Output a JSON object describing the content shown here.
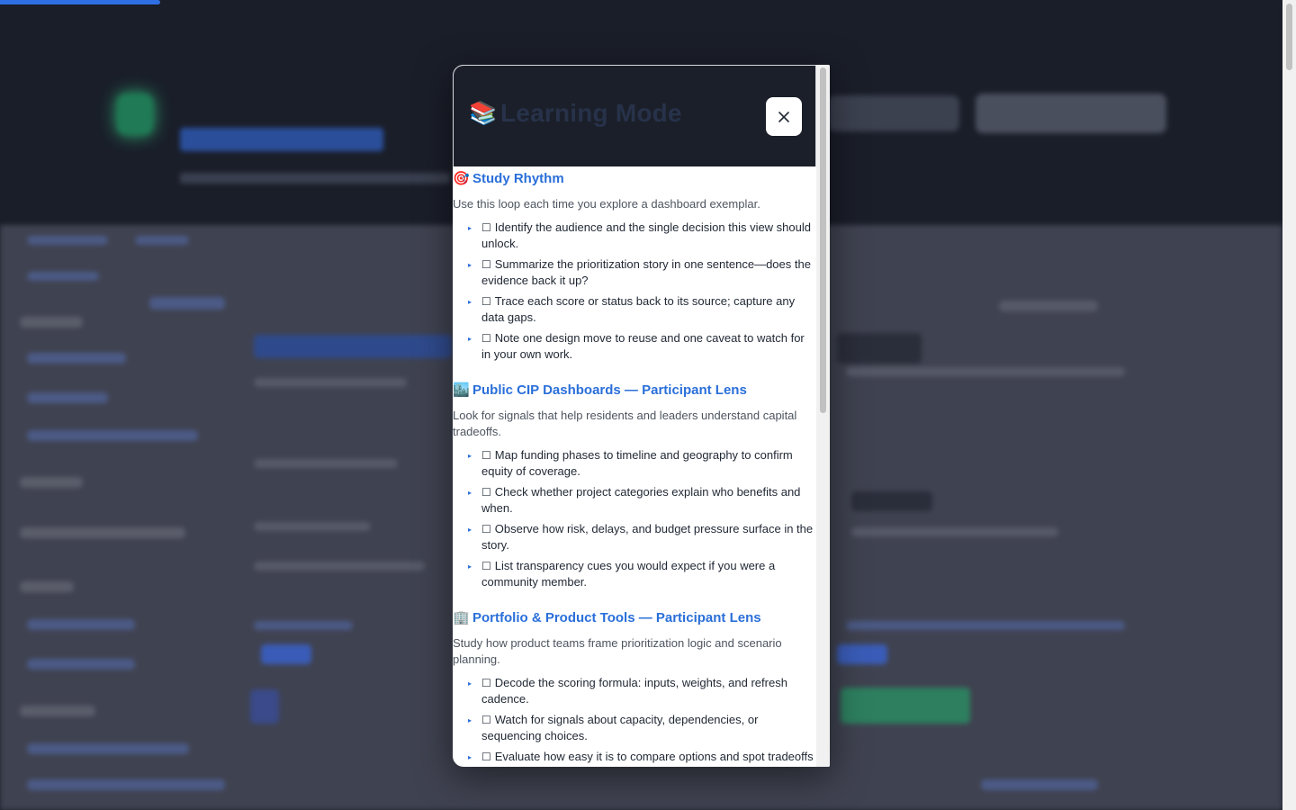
{
  "modal": {
    "icon": "📚",
    "title": "Learning Mode",
    "close_icon": "close-icon",
    "sections": [
      {
        "emoji": "🎯",
        "title": "Study Rhythm",
        "description": "Use this loop each time you explore a dashboard exemplar.",
        "items": [
          "Identify the audience and the single decision this view should unlock.",
          "Summarize the prioritization story in one sentence—does the evidence back it up?",
          "Trace each score or status back to its source; capture any data gaps.",
          "Note one design move to reuse and one caveat to watch for in your own work."
        ]
      },
      {
        "emoji": "🏙️",
        "title": "Public CIP Dashboards — Participant Lens",
        "description": "Look for signals that help residents and leaders understand capital tradeoffs.",
        "items": [
          "Map funding phases to timeline and geography to confirm equity of coverage.",
          "Check whether project categories explain who benefits and when.",
          "Observe how risk, delays, and budget pressure surface in the story.",
          "List transparency cues you would expect if you were a community member."
        ]
      },
      {
        "emoji": "🏢",
        "title": "Portfolio & Product Tools — Participant Lens",
        "description": "Study how product teams frame prioritization logic and scenario planning.",
        "items": [
          "Decode the scoring formula: inputs, weights, and refresh cadence.",
          "Watch for signals about capacity, dependencies, or sequencing choices.",
          "Evaluate how easy it is to compare options and spot tradeoffs quickly."
        ]
      }
    ],
    "checkbox_glyph": "☐",
    "bullet_glyph": "▸"
  },
  "colors": {
    "accent": "#2a6fd9",
    "header_bg": "#1b1f29",
    "title_text": "#27324a"
  }
}
